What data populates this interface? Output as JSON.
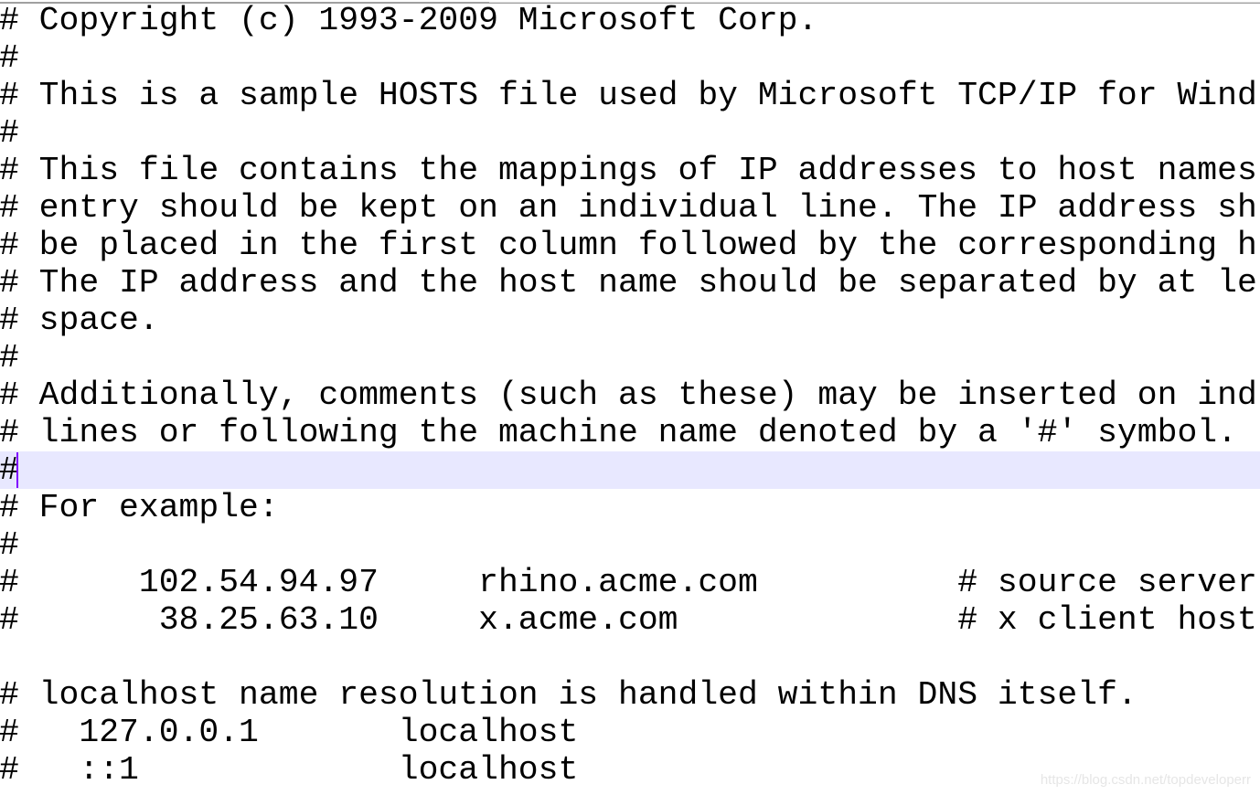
{
  "editor": {
    "current_line": 12,
    "lines": [
      "# Copyright (c) 1993-2009 Microsoft Corp.",
      "#",
      "# This is a sample HOSTS file used by Microsoft TCP/IP for Wind",
      "#",
      "# This file contains the mappings of IP addresses to host names",
      "# entry should be kept on an individual line. The IP address sh",
      "# be placed in the first column followed by the corresponding h",
      "# The IP address and the host name should be separated by at le",
      "# space.",
      "#",
      "# Additionally, comments (such as these) may be inserted on ind",
      "# lines or following the machine name denoted by a '#' symbol.",
      "#",
      "# For example:",
      "#",
      "#      102.54.94.97     rhino.acme.com          # source server",
      "#       38.25.63.10     x.acme.com              # x client host",
      "",
      "# localhost name resolution is handled within DNS itself.",
      "#   127.0.0.1       localhost",
      "#   ::1             localhost"
    ]
  },
  "watermark": "https://blog.csdn.net/topdeveloperr",
  "colors": {
    "current_line": "#e8e8ff",
    "caret": "#8000ff"
  }
}
